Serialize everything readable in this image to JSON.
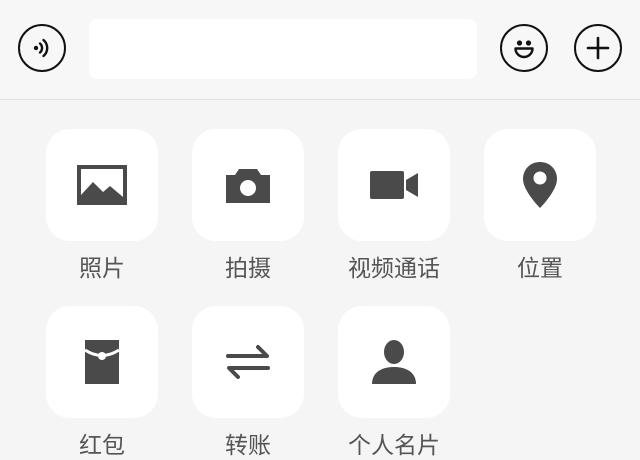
{
  "input_bar": {
    "voice_icon": "voice-wave-icon",
    "emoji_icon": "smiley-face-icon",
    "plus_icon": "plus-icon",
    "message_value": "",
    "message_placeholder": ""
  },
  "panel": {
    "items": [
      {
        "label": "照片",
        "icon": "photo-icon"
      },
      {
        "label": "拍摄",
        "icon": "camera-icon"
      },
      {
        "label": "视频通话",
        "icon": "video-call-icon"
      },
      {
        "label": "位置",
        "icon": "location-pin-icon"
      },
      {
        "label": "红包",
        "icon": "red-packet-icon"
      },
      {
        "label": "转账",
        "icon": "transfer-icon"
      },
      {
        "label": "个人名片",
        "icon": "contact-card-icon"
      }
    ]
  },
  "colors": {
    "background": "#f5f5f5",
    "tile": "#ffffff",
    "icon": "#4a4a4a",
    "label": "#555555"
  }
}
